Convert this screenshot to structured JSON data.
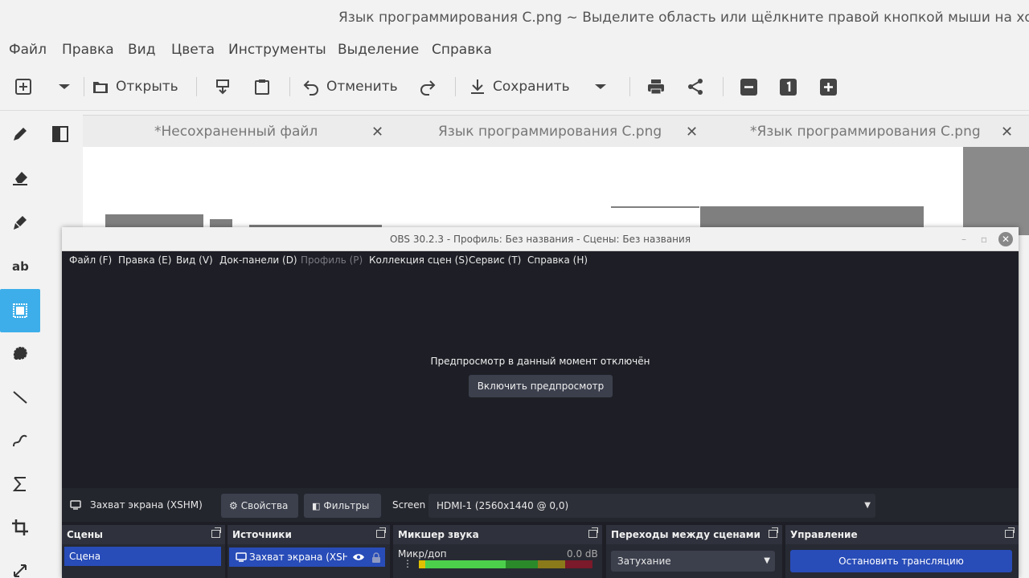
{
  "pinta": {
    "window_title": "Язык программирования C.png ~ Выделите область или щёлкните правой кнопкой мыши на холсте",
    "menu": [
      "Файл",
      "Правка",
      "Вид",
      "Цвета",
      "Инструменты",
      "Выделение",
      "Справка"
    ],
    "toolbar": {
      "open_label": "Открыть",
      "undo_label": "Отменить",
      "save_label": "Сохранить"
    },
    "tabs": [
      "*Несохраненный файл",
      "Язык программирования C.png",
      "*Язык программирования C.png"
    ],
    "tab_close": "✕",
    "active_tool": "rectangle-select"
  },
  "obs": {
    "window_title": "OBS 30.2.3 - Профиль: Без названия - Сцены: Без названия",
    "menu": [
      {
        "label": "Файл (F)",
        "enabled": true
      },
      {
        "label": "Правка (E)",
        "enabled": true
      },
      {
        "label": "Вид (V)",
        "enabled": true
      },
      {
        "label": "Док-панели (D)",
        "enabled": true
      },
      {
        "label": "Профиль (P)",
        "enabled": false
      },
      {
        "label": "Коллекция сцен (S)",
        "enabled": true
      },
      {
        "label": "Сервис (T)",
        "enabled": true
      },
      {
        "label": "Справка (H)",
        "enabled": true
      }
    ],
    "preview": {
      "message": "Предпросмотр в данный момент отключён",
      "enable_button": "Включить предпросмотр"
    },
    "source_bar": {
      "source_name": "Захват экрана (XSHM)",
      "properties_button": "Свойства",
      "filters_button": "Фильтры",
      "screen_label": "Screen",
      "screen_value": "HDMI-1 (2560x1440 @ 0,0)"
    },
    "docks": {
      "scenes": {
        "title": "Сцены",
        "items": [
          "Сцена"
        ]
      },
      "sources": {
        "title": "Источники",
        "items": [
          "Захват экрана (XSHM"
        ]
      },
      "mixer": {
        "title": "Микшер звука",
        "channel": "Микр/доп",
        "level": "0.0 dB"
      },
      "transitions": {
        "title": "Переходы между сценами",
        "selected": "Затухание"
      },
      "controls": {
        "title": "Управление",
        "stop_stream_button": "Остановить трансляцию"
      }
    },
    "colors": {
      "bg": "#1e1f26",
      "accent": "#284cb8",
      "button": "#3c404d"
    }
  }
}
